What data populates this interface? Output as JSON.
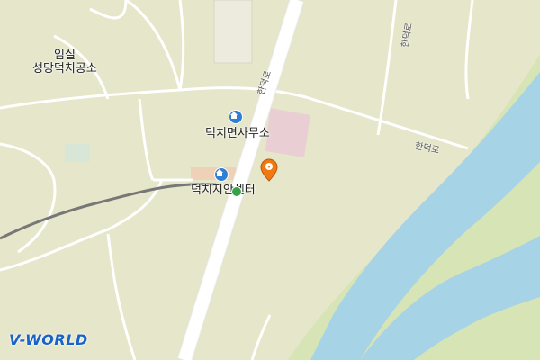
{
  "map": {
    "places": {
      "imsil_line1": "임실",
      "imsil_line2": "성당덕치공소",
      "office": "덕치면사무소",
      "center": "덕치지안센터"
    },
    "roads": {
      "road_a": "한덕로",
      "road_b": "한덕로",
      "road_c": "한덕로"
    },
    "logo": "V-WORLD"
  },
  "colors": {
    "land": "#e6e6ca",
    "road": "#ffffff",
    "water": "#a7d3e6",
    "river_bank": "#cfe2b0",
    "parcel": "#e9cfd4",
    "marker": "#f07a11",
    "poi": "#2f7fd6"
  },
  "icons": {
    "office_icon": "home-icon",
    "center_icon": "home-icon",
    "marker_icon": "location-pin-icon",
    "station_icon": "station-icon"
  }
}
